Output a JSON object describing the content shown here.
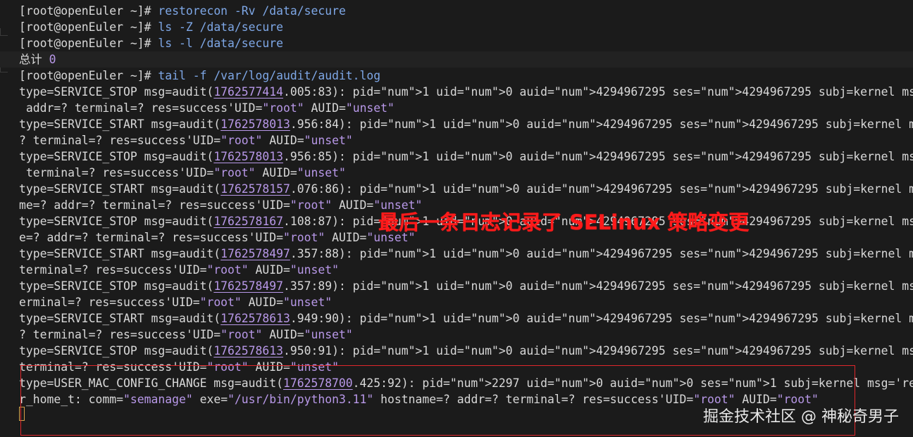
{
  "terminal": {
    "prompt": "[root@openEuler ~]",
    "hash": "#",
    "commands": [
      "restorecon -Rv /data/secure",
      "ls -Z /data/secure",
      "ls -l /data/secure"
    ],
    "total_label": "总计",
    "total_value": "0",
    "tail_command": "tail -f /var/log/audit/audit.log",
    "log": [
      {
        "type": "type=SERVICE_STOP msg=audit(",
        "ts": "1762577414",
        "rest": ".005:83): pid=1 uid=0 auid=4294967295 ses=4294967295 subj=kernel msg='unit=systemd-tmpfil",
        "cont": " addr=? terminal=? res=success'UID=\"root\" AUID=\"unset\""
      },
      {
        "type": "type=SERVICE_START msg=audit(",
        "ts": "1762578013",
        "rest": ".956:84): pid=1 uid=0 auid=4294967295 ses=4294967295 subj=kernel msg='unit=sysstat-colle",
        "cont": "? terminal=? res=success'UID=\"root\" AUID=\"unset\""
      },
      {
        "type": "type=SERVICE_STOP msg=audit(",
        "ts": "1762578013",
        "rest": ".956:85): pid=1 uid=0 auid=4294967295 ses=4294967295 subj=kernel msg='unit=sysstat-collec",
        "cont": " terminal=? res=success'UID=\"root\" AUID=\"unset\""
      },
      {
        "type": "type=SERVICE_START msg=audit(",
        "ts": "1762578157",
        "rest": ".076:86): pid=1 uid=0 auid=4294967295 ses=4294967295 subj=kernel msg='unit=NetworkManage",
        "cont": "me=? addr=? terminal=? res=success'UID=\"root\" AUID=\"unset\""
      },
      {
        "type": "type=SERVICE_STOP msg=audit(",
        "ts": "1762578167",
        "rest": ".108:87): pid=1 uid=0 auid=4294967295 ses=4294967295 subj=kernel msg='unit=NetworkManager",
        "cont": "e=? addr=? terminal=? res=success'UID=\"root\" AUID=\"unset\""
      },
      {
        "type": "type=SERVICE_START msg=audit(",
        "ts": "1762578497",
        "rest": ".357:88): pid=1 uid=0 auid=4294967295 ses=4294967295 subj=kernel msg='unit=dnf-makecache",
        "cont": "terminal=? res=success'UID=\"root\" AUID=\"unset\""
      },
      {
        "type": "type=SERVICE_STOP msg=audit(",
        "ts": "1762578497",
        "rest": ".357:89): pid=1 uid=0 auid=4294967295 ses=4294967295 subj=kernel msg='unit=dnf-makecache",
        "cont": "erminal=? res=success'UID=\"root\" AUID=\"unset\""
      },
      {
        "type": "type=SERVICE_START msg=audit(",
        "ts": "1762578613",
        "rest": ".949:90): pid=1 uid=0 auid=4294967295 ses=4294967295 subj=kernel msg='unit=sysstat-colle",
        "cont": "? terminal=? res=success'UID=\"root\" AUID=\"unset\""
      },
      {
        "type": "type=SERVICE_STOP msg=audit(",
        "ts": "1762578613",
        "rest": ".950:91): pid=1 uid=0 auid=4294967295 ses=4294967295 subj=kernel msg='unit=sysstat-collec",
        "cont": "terminal=? res=success'UID=\"root\" AUID=\"unset\""
      },
      {
        "type": "type=USER_MAC_CONFIG_CHANGE msg=audit(",
        "ts": "1762578700",
        "rest": ".425:92): pid=2297 uid=0 auid=0 ses=1 subj=kernel msg='resrc=fcontext op=add tg",
        "cont": "r_home_t: comm=\"semanage\" exe=\"/usr/bin/python3.11\" hostname=? addr=? terminal=? res=success'UID=\"root\" AUID=\"root\""
      }
    ]
  },
  "annotation": {
    "text": "最后一条日志记录了 SELinux 策略变更",
    "color": "#ff1a1a",
    "box_color": "#e0262b"
  },
  "watermark": "掘金技术社区 @ 神秘奇男子",
  "colors": {
    "background": "#1b1b1b",
    "command": "#7ea7e6",
    "number": "#b898e8",
    "text": "#d8d8d8"
  }
}
